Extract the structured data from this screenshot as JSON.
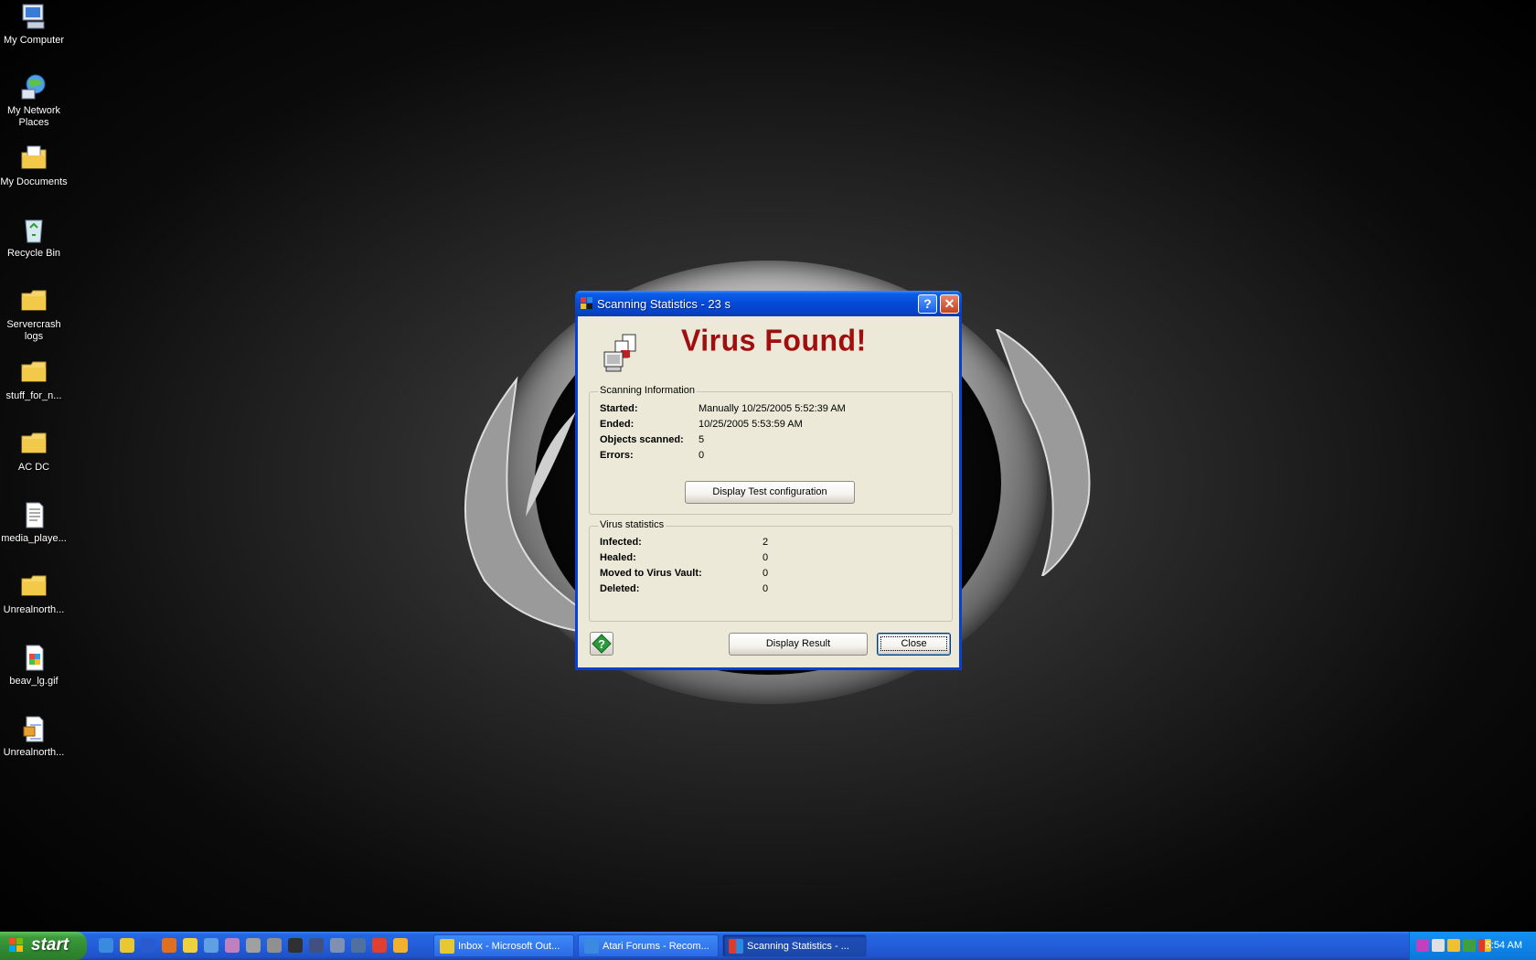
{
  "desktop_icons": [
    {
      "label": "My Computer"
    },
    {
      "label": "My Network Places"
    },
    {
      "label": "My Documents"
    },
    {
      "label": "Recycle Bin"
    },
    {
      "label": "Servercrash logs"
    },
    {
      "label": "stuff_for_n..."
    },
    {
      "label": "AC DC"
    },
    {
      "label": "media_playe..."
    },
    {
      "label": "Unrealnorth..."
    },
    {
      "label": "beav_lg.gif"
    },
    {
      "label": "Unrealnorth..."
    }
  ],
  "dialog": {
    "title": "Scanning Statistics - 23 s",
    "headline": "Virus Found!",
    "scan_info": {
      "legend": "Scanning Information",
      "rows": [
        {
          "key": "Started:",
          "value": "Manually 10/25/2005 5:52:39 AM"
        },
        {
          "key": "Ended:",
          "value": "10/25/2005 5:53:59 AM"
        },
        {
          "key": "Objects scanned:",
          "value": "5"
        },
        {
          "key": "Errors:",
          "value": "0"
        }
      ],
      "config_button": "Display Test configuration"
    },
    "virus_stats": {
      "legend": "Virus statistics",
      "rows": [
        {
          "key": "Infected:",
          "value": "2"
        },
        {
          "key": "Healed:",
          "value": "0"
        },
        {
          "key": "Moved to Virus Vault:",
          "value": "0"
        },
        {
          "key": "Deleted:",
          "value": "0"
        }
      ]
    },
    "display_result_button": "Display Result",
    "close_button": "Close"
  },
  "taskbar": {
    "start_label": "start",
    "tasks": [
      {
        "label": "Inbox - Microsoft Out..."
      },
      {
        "label": "Atari Forums - Recom..."
      },
      {
        "label": "Scanning Statistics - ..."
      }
    ],
    "clock": "5:54 AM"
  }
}
